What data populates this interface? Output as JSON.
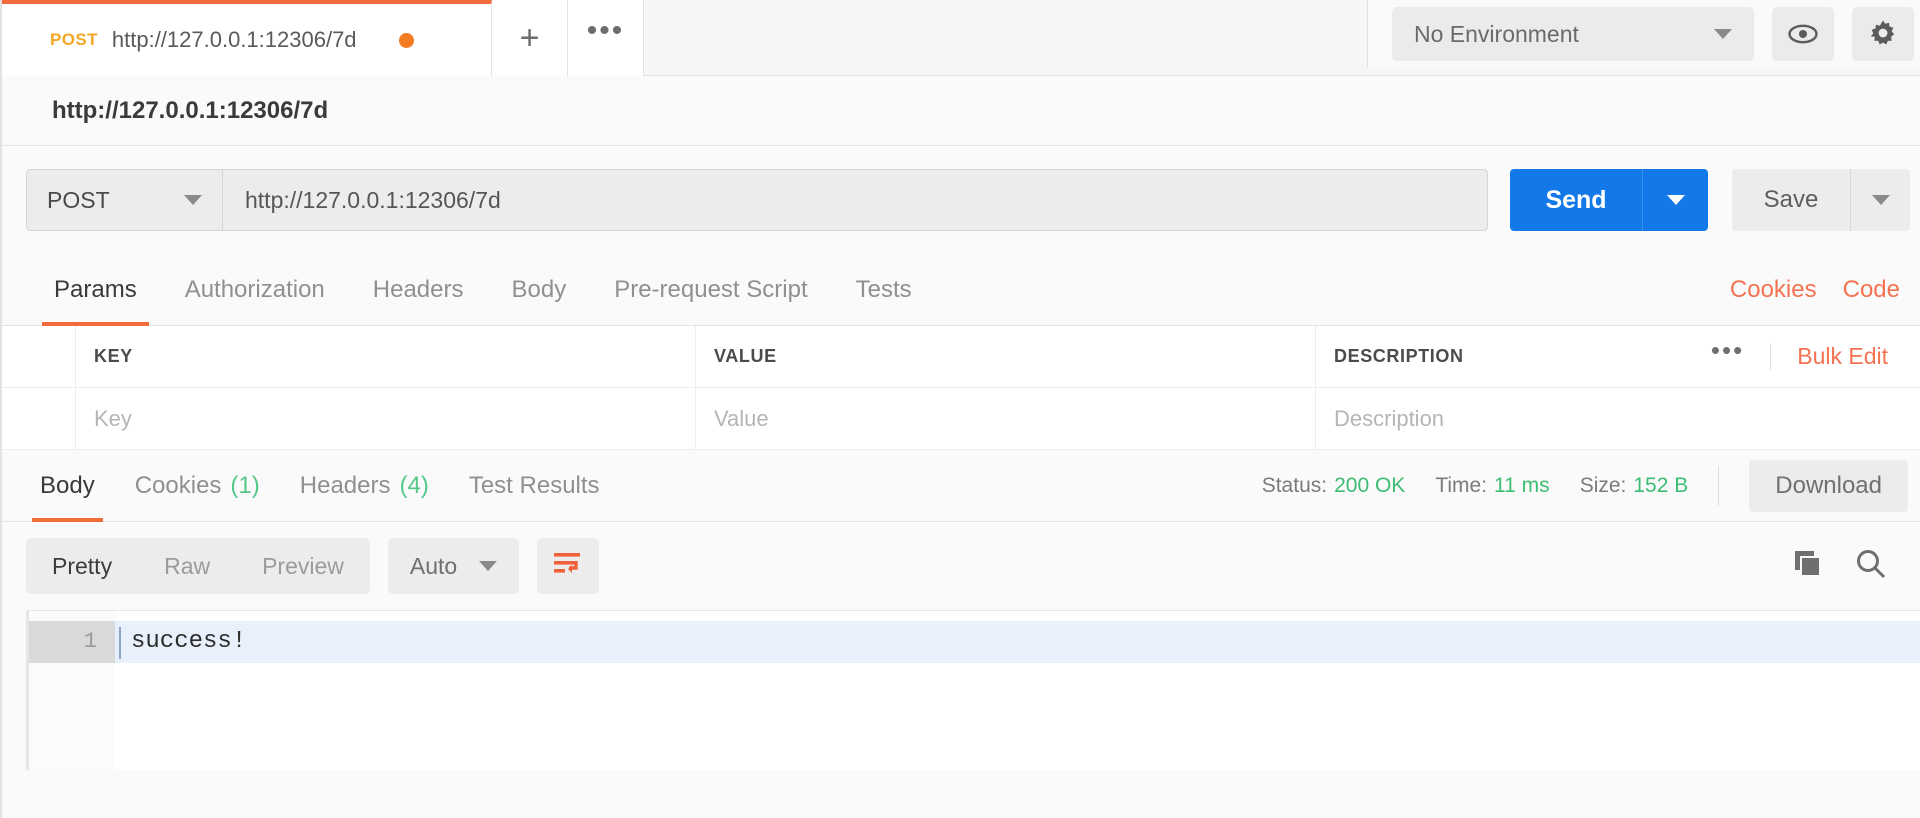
{
  "tab_strip": {
    "request_tab": {
      "method": "POST",
      "url": "http://127.0.0.1:12306/7d"
    },
    "new_tab_label": "+",
    "more_label": "•••"
  },
  "environment": {
    "selected": "No Environment",
    "eye_icon": "eye-icon",
    "gear_icon": "gear-icon"
  },
  "request_name": "http://127.0.0.1:12306/7d",
  "url_bar": {
    "method": "POST",
    "url": "http://127.0.0.1:12306/7d",
    "send_label": "Send",
    "save_label": "Save"
  },
  "request_tabs": {
    "items": [
      {
        "label": "Params",
        "active": true
      },
      {
        "label": "Authorization",
        "active": false
      },
      {
        "label": "Headers",
        "active": false
      },
      {
        "label": "Body",
        "active": false
      },
      {
        "label": "Pre-request Script",
        "active": false
      },
      {
        "label": "Tests",
        "active": false
      }
    ],
    "cookies_link": "Cookies",
    "code_link": "Code"
  },
  "params_table": {
    "headers": {
      "key": "KEY",
      "value": "VALUE",
      "description": "DESCRIPTION"
    },
    "more_label": "•••",
    "bulk_edit_label": "Bulk Edit",
    "placeholders": {
      "key": "Key",
      "value": "Value",
      "description": "Description"
    }
  },
  "response": {
    "tabs": [
      {
        "label": "Body",
        "count": "",
        "active": true
      },
      {
        "label": "Cookies",
        "count": "(1)",
        "active": false
      },
      {
        "label": "Headers",
        "count": "(4)",
        "active": false
      },
      {
        "label": "Test Results",
        "count": "",
        "active": false
      }
    ],
    "status_label": "Status:",
    "status_value": "200 OK",
    "time_label": "Time:",
    "time_value": "11 ms",
    "size_label": "Size:",
    "size_value": "152 B",
    "download_label": "Download",
    "view_modes": [
      {
        "label": "Pretty",
        "active": true
      },
      {
        "label": "Raw",
        "active": false
      },
      {
        "label": "Preview",
        "active": false
      }
    ],
    "format_selected": "Auto",
    "wrap_icon": "word-wrap-icon",
    "copy_icon": "copy-icon",
    "search_icon": "search-icon",
    "body_lines": [
      {
        "number": "1",
        "text": "success!"
      }
    ]
  },
  "colors": {
    "accent_orange": "#f26b3a",
    "method_orange": "#f5a623",
    "send_blue": "#1479e8",
    "status_green": "#3dbd74",
    "link_orange": "#f47352"
  }
}
